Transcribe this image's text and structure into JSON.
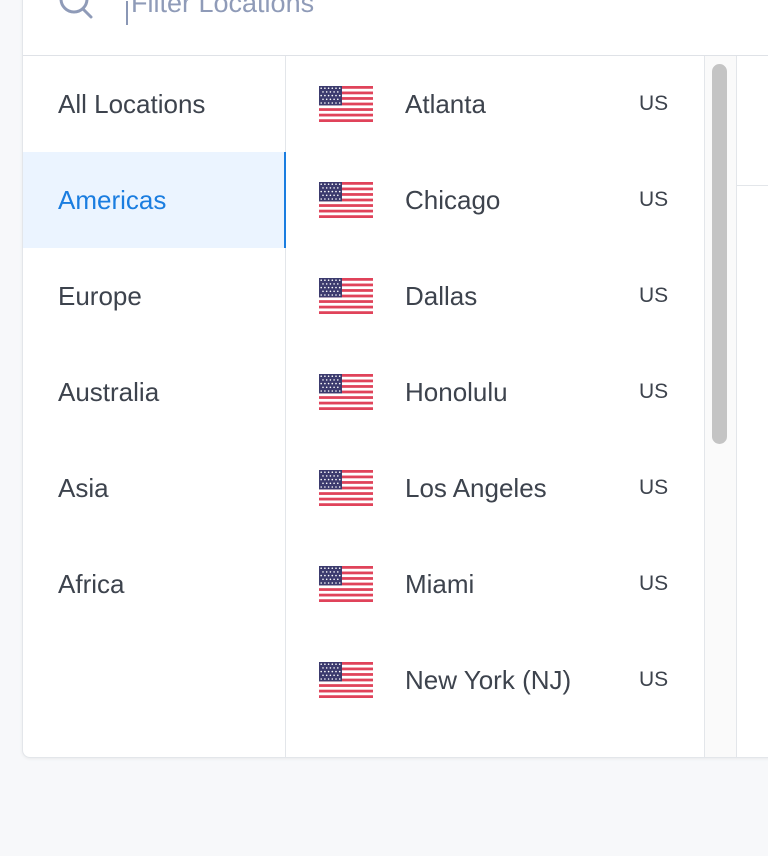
{
  "search": {
    "placeholder": "Filter Locations",
    "icon": "search-icon"
  },
  "regions": [
    {
      "label": "All Locations",
      "active": false
    },
    {
      "label": "Americas",
      "active": true
    },
    {
      "label": "Europe",
      "active": false
    },
    {
      "label": "Australia",
      "active": false
    },
    {
      "label": "Asia",
      "active": false
    },
    {
      "label": "Africa",
      "active": false
    }
  ],
  "cities": [
    {
      "name": "Atlanta",
      "country": "US",
      "flag": "us-flag-icon"
    },
    {
      "name": "Chicago",
      "country": "US",
      "flag": "us-flag-icon"
    },
    {
      "name": "Dallas",
      "country": "US",
      "flag": "us-flag-icon"
    },
    {
      "name": "Honolulu",
      "country": "US",
      "flag": "us-flag-icon"
    },
    {
      "name": "Los Angeles",
      "country": "US",
      "flag": "us-flag-icon"
    },
    {
      "name": "Miami",
      "country": "US",
      "flag": "us-flag-icon"
    },
    {
      "name": "New York (NJ)",
      "country": "US",
      "flag": "us-flag-icon"
    }
  ],
  "colors": {
    "accent": "#1a7de0",
    "active_bg": "#ebf4ff",
    "text": "#3d434d",
    "flag_red": "#e0435a",
    "flag_blue": "#3c3b6e"
  }
}
